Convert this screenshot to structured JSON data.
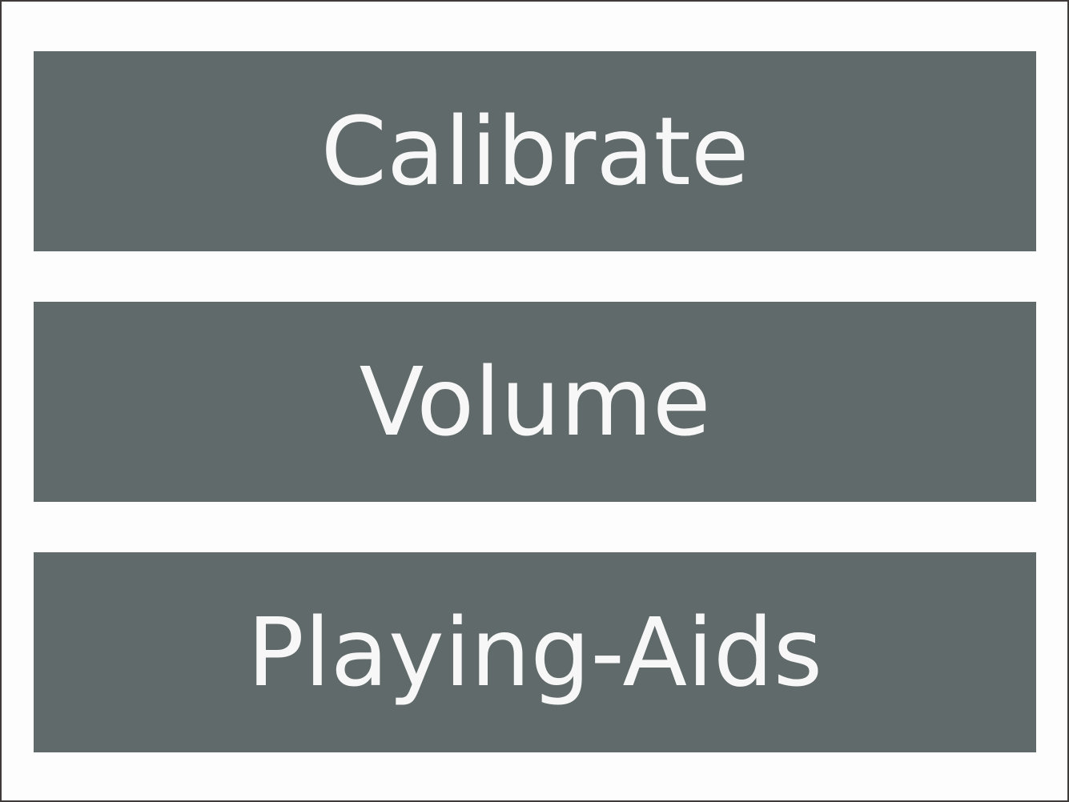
{
  "menu": {
    "items": [
      {
        "label": "Calibrate"
      },
      {
        "label": "Volume"
      },
      {
        "label": "Playing-Aids"
      }
    ]
  },
  "colors": {
    "background": "#fdfdfd",
    "button_fill": "#616a6a",
    "button_text": "#f7f7f7",
    "frame_border": "#403b3b"
  }
}
